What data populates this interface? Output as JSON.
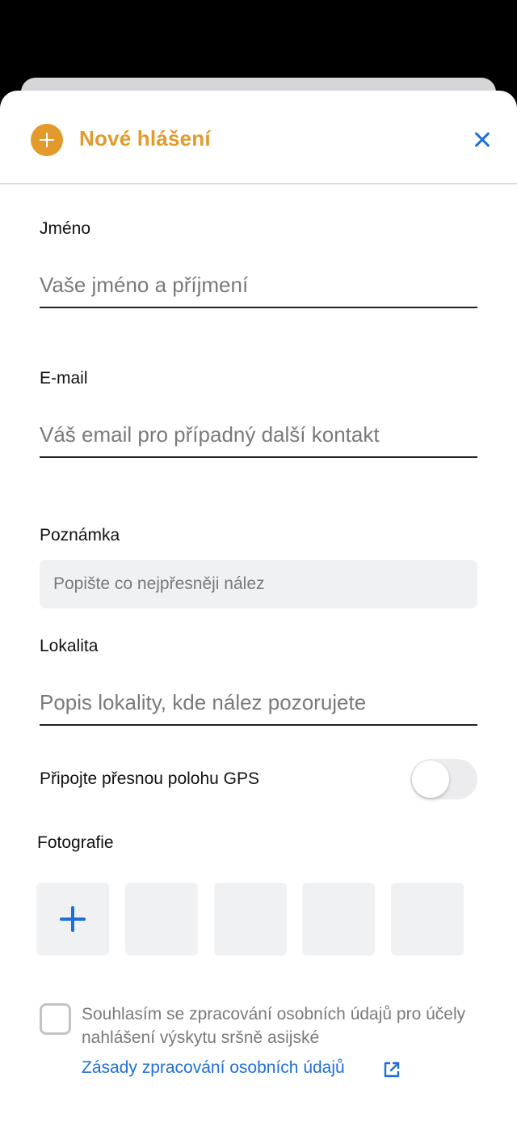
{
  "header": {
    "title": "Nové hlášení",
    "accent_color": "#e39a2c",
    "close_icon": "close-icon",
    "add_icon": "plus-circle-icon"
  },
  "form": {
    "name": {
      "label": "Jméno",
      "placeholder": "Vaše jméno a příjmení",
      "value": ""
    },
    "email": {
      "label": "E-mail",
      "placeholder": "Váš email pro případný další kontakt",
      "value": ""
    },
    "note": {
      "label": "Poznámka",
      "placeholder": "Popište co nejpřesněji nález",
      "value": ""
    },
    "location": {
      "label": "Lokalita",
      "placeholder": "Popis lokality, kde nález pozorujete",
      "value": ""
    },
    "gps": {
      "label": "Připojte přesnou polohu GPS",
      "enabled": false
    },
    "photos": {
      "label": "Fotografie",
      "add_icon": "plus-icon",
      "slot_count": 5
    },
    "consent": {
      "checked": false,
      "text": "Souhlasím se zpracování osobních údajů pro účely nahlášení výskytu sršně asijské",
      "link_label": "Zásady zpracování osobních údajů",
      "link_icon": "external-link-icon"
    }
  },
  "colors": {
    "link_blue": "#1f6fd8",
    "field_bg": "#f0f1f3",
    "backdrop": "#000000"
  }
}
